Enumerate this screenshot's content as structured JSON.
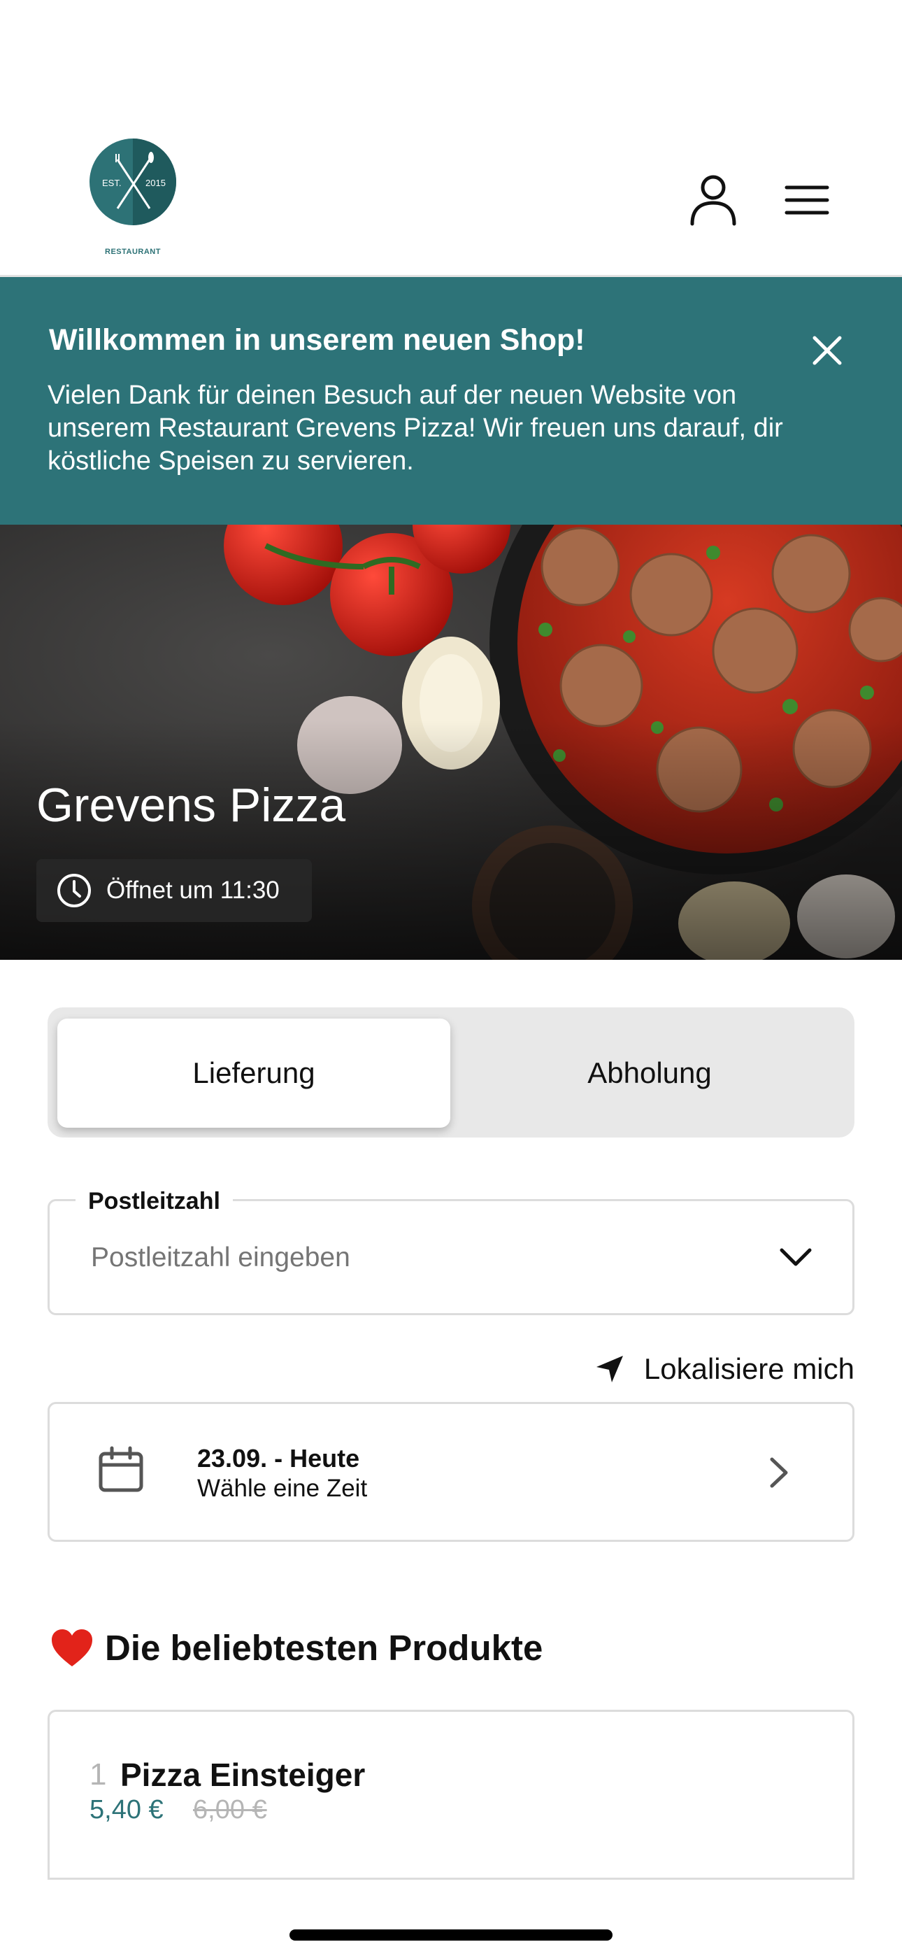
{
  "header": {
    "logo": {
      "top_text": "EST.",
      "year": "2015",
      "sub": "RESTAURANT"
    },
    "account_icon": "person-icon",
    "menu_icon": "hamburger-menu-icon"
  },
  "banner": {
    "title": "Willkommen in unserem neuen Shop!",
    "text": "Vielen Dank für deinen Besuch auf der neuen Website von unserem Restaurant Grevens Pizza! Wir freuen uns darauf, dir köstliche Speisen zu servieren.",
    "close_icon": "close-icon",
    "color": "#2d7378"
  },
  "hero": {
    "title": "Grevens Pizza",
    "hours": "Öffnet um 11:30",
    "hours_icon": "clock-icon"
  },
  "order_mode": {
    "options": [
      "Lieferung",
      "Abholung"
    ],
    "selected": "Lieferung"
  },
  "postcode": {
    "label": "Postleitzahl",
    "placeholder": "Postleitzahl eingeben",
    "value": ""
  },
  "locate": {
    "label": "Lokalisiere mich",
    "icon": "location-arrow-icon"
  },
  "schedule": {
    "date": "23.09. - Heute",
    "hint": "Wähle eine Zeit",
    "icon": "calendar-icon"
  },
  "popular": {
    "title": "Die beliebtesten Produkte",
    "icon": "heart-icon",
    "items": [
      {
        "rank": "1",
        "name": "Pizza Einsteiger",
        "price": "5,40 €",
        "old_price": "6,00 €"
      }
    ]
  }
}
